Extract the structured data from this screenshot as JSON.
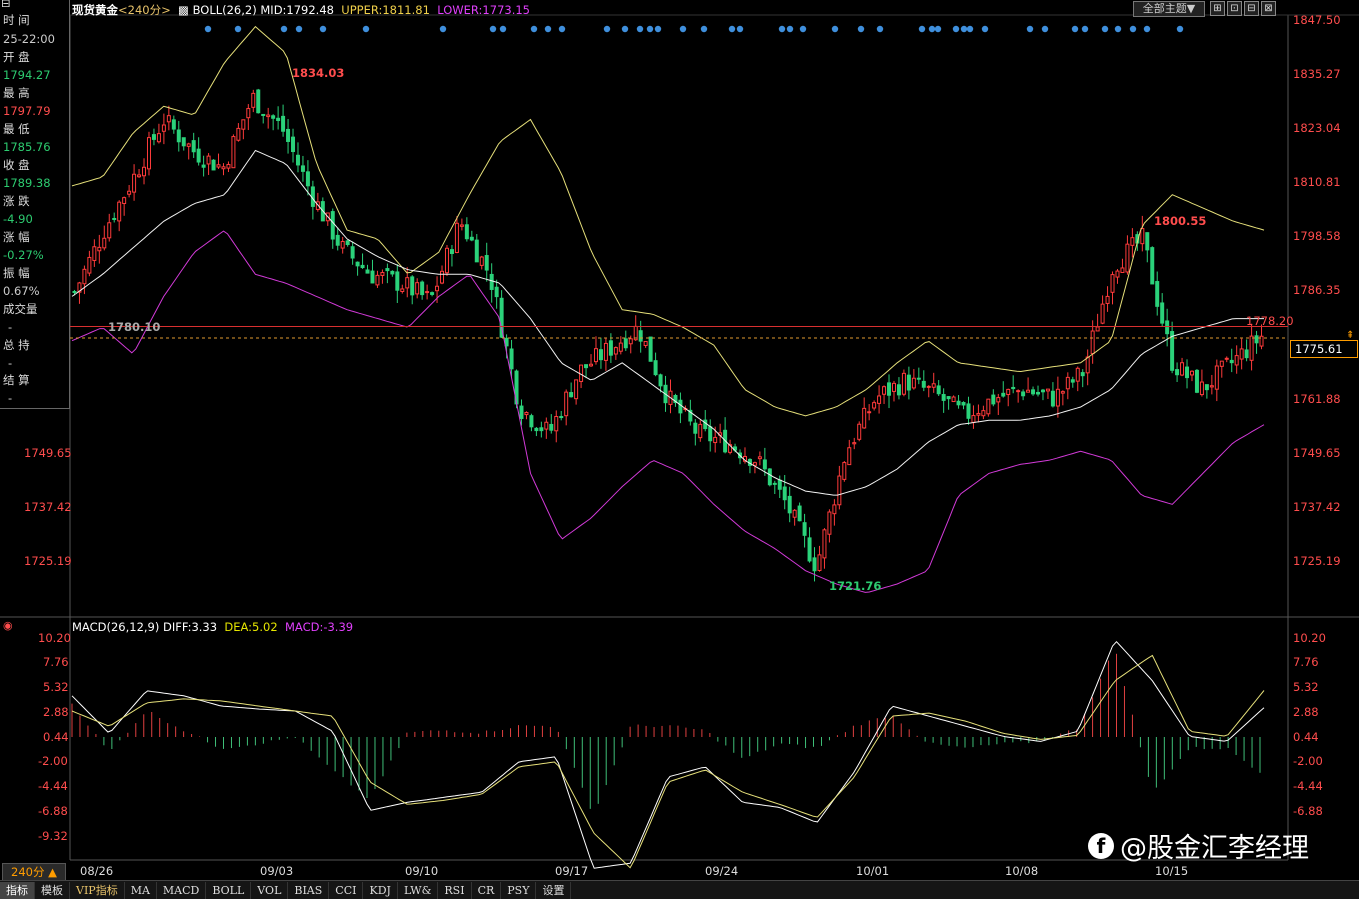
{
  "header": {
    "title": "现货黄金",
    "period": "<240分>",
    "indicator": "BOLL(26,2)",
    "mid": "MID:1792.48",
    "upper": "UPPER:1811.81",
    "lower": "LOWER:1773.15"
  },
  "toolbar": {
    "theme_select": "全部主题▼",
    "buttons": [
      "⊞",
      "⊡",
      "⊟",
      "⊠"
    ]
  },
  "info_panel": {
    "time_label": "时 间",
    "time_value": "25-22:00",
    "open_label": "开 盘",
    "open_value": "1794.27",
    "high_label": "最 高",
    "high_value": "1797.79",
    "low_label": "最 低",
    "low_value": "1785.76",
    "close_label": "收 盘",
    "close_value": "1789.38",
    "change_label": "涨 跌",
    "change_value": "-4.90",
    "change_pct_label": "涨 幅",
    "change_pct_value": "-0.27%",
    "amplitude_label": "振 幅",
    "amplitude_value": "0.67%",
    "volume_label": "成交量",
    "volume_value": "-",
    "open_interest_label": "总 持",
    "open_interest_value": "-",
    "settlement_label": "结 算",
    "settlement_value": "-"
  },
  "main_axis": {
    "right_labels": [
      "1847.50",
      "1835.27",
      "1823.04",
      "1810.81",
      "1798.58",
      "1786.35",
      "1761.88",
      "1749.65",
      "1737.42",
      "1725.19"
    ],
    "left_labels": [
      "1749.65",
      "1737.42",
      "1725.19"
    ],
    "current_price": "1775.61"
  },
  "annotations": {
    "high_1": "1834.03",
    "low_1": "1780.10",
    "high_2": "1800.55",
    "low_2": "1721.76",
    "ref_line": "1778.20"
  },
  "macd_header": {
    "name": "MACD(26,12,9)",
    "diff": "DIFF:3.33",
    "dea": "DEA:5.02",
    "macd": "MACD:-3.39"
  },
  "macd_axis": {
    "labels": [
      "10.20",
      "7.76",
      "5.32",
      "2.88",
      "0.44",
      "-2.00",
      "-4.44",
      "-6.88",
      "-9.32"
    ]
  },
  "x_axis": {
    "labels": [
      "08/26",
      "09/03",
      "09/10",
      "09/17",
      "09/24",
      "10/01",
      "10/08",
      "10/15"
    ]
  },
  "period_box": "240分 ▲",
  "bottom_tabs": [
    "指标",
    "模板",
    "VIP指标",
    "MA",
    "MACD",
    "BOLL",
    "VOL",
    "BIAS",
    "CCI",
    "KDJ",
    "LW&",
    "RSI",
    "CR",
    "PSY",
    "设置"
  ],
  "watermark": "@股金汇李经理",
  "chart_data": {
    "type": "candlestick",
    "title": "现货黄金 <240分>",
    "x": [
      "08/26",
      "09/03",
      "09/10",
      "09/17",
      "09/24",
      "10/01",
      "10/08",
      "10/15"
    ],
    "ylim": [
      1715,
      1850
    ],
    "close_series": [
      1786,
      1800,
      1812,
      1825,
      1818,
      1814,
      1830,
      1823,
      1808,
      1796,
      1790,
      1788,
      1784,
      1802,
      1790,
      1760,
      1754,
      1768,
      1773,
      1778,
      1762,
      1754,
      1752,
      1748,
      1738,
      1724,
      1750,
      1762,
      1766,
      1763,
      1758,
      1762,
      1764,
      1762,
      1768,
      1792,
      1798,
      1770,
      1764,
      1770,
      1776
    ],
    "boll_upper": [
      1810,
      1812,
      1822,
      1828,
      1826,
      1838,
      1846,
      1840,
      1815,
      1800,
      1798,
      1790,
      1795,
      1808,
      1820,
      1825,
      1813,
      1795,
      1782,
      1781,
      1778,
      1774,
      1764,
      1760,
      1758,
      1760,
      1764,
      1770,
      1775,
      1770,
      1769,
      1768,
      1769,
      1770,
      1775,
      1801,
      1808,
      1805,
      1802,
      1800
    ],
    "boll_mid": [
      1785,
      1790,
      1796,
      1802,
      1806,
      1808,
      1818,
      1815,
      1806,
      1798,
      1794,
      1791,
      1790,
      1790,
      1788,
      1780,
      1770,
      1766,
      1770,
      1765,
      1760,
      1755,
      1748,
      1744,
      1741,
      1740,
      1742,
      1746,
      1752,
      1756,
      1757,
      1757,
      1758,
      1760,
      1764,
      1772,
      1776,
      1778,
      1780,
      1780
    ],
    "boll_lower": [
      1775,
      1778,
      1772,
      1785,
      1795,
      1800,
      1790,
      1788,
      1785,
      1782,
      1780,
      1778,
      1785,
      1790,
      1780,
      1745,
      1730,
      1735,
      1742,
      1748,
      1745,
      1738,
      1732,
      1728,
      1723,
      1720,
      1718,
      1720,
      1723,
      1740,
      1745,
      1747,
      1748,
      1750,
      1748,
      1740,
      1738,
      1745,
      1752,
      1756
    ],
    "macd_diff": [
      4.5,
      0.8,
      5.0,
      4.5,
      3.5,
      3.2,
      3.0,
      1.0,
      -6.8,
      -6.0,
      -5.5,
      -5.0,
      -2.0,
      -1.5,
      -12.5,
      -12.0,
      -3.5,
      -2.5,
      -6.0,
      -6.5,
      -8.0,
      -3.0,
      3.5,
      2.5,
      1.5,
      0.5,
      0.0,
      1.0,
      10.0,
      6.0,
      0.5,
      0.0,
      3.33
    ],
    "macd_dea": [
      3.0,
      1.5,
      3.8,
      4.2,
      4.0,
      3.5,
      3.0,
      2.5,
      -4.0,
      -6.2,
      -5.8,
      -5.2,
      -2.5,
      -2.0,
      -9.0,
      -12.5,
      -4.0,
      -2.8,
      -5.0,
      -6.2,
      -7.5,
      -3.5,
      2.5,
      2.8,
      2.0,
      0.8,
      0.2,
      0.6,
      6.0,
      8.5,
      1.0,
      0.5,
      5.02
    ]
  }
}
